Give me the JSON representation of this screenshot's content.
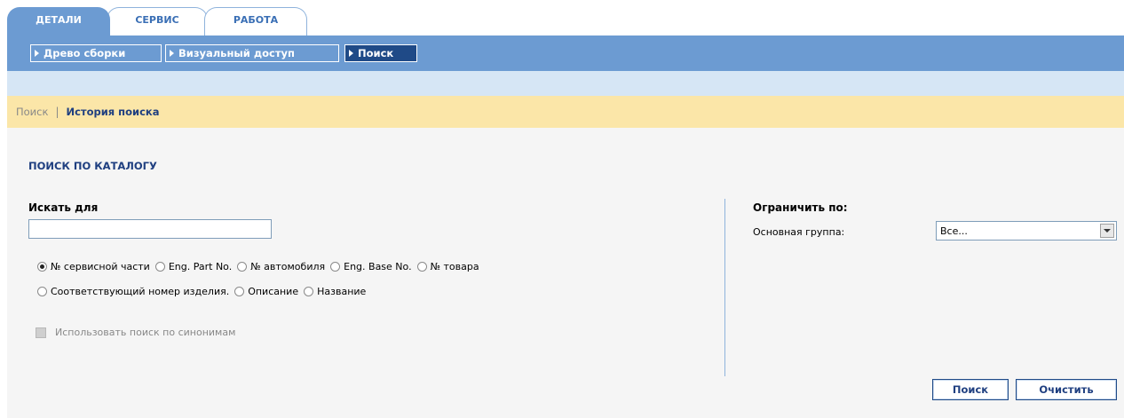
{
  "tabs": [
    {
      "label": "ДЕТАЛИ",
      "active": true
    },
    {
      "label": "СЕРВИС",
      "active": false
    },
    {
      "label": "РАБОТА",
      "active": false
    }
  ],
  "subnav": [
    {
      "label": "Древо сборки",
      "active": false
    },
    {
      "label": "Визуальный доступ",
      "active": false
    },
    {
      "label": "Поиск",
      "active": true
    }
  ],
  "breadcrumb": {
    "inactive": "Поиск",
    "separator": "|",
    "active": "История поиска"
  },
  "section_title": "ПОИСК ПО КАТАЛОГУ",
  "search_for": {
    "label": "Искать для",
    "value": ""
  },
  "radios_row1": [
    {
      "label": "№ сервисной части",
      "checked": true
    },
    {
      "label": "Eng. Part No.",
      "checked": false
    },
    {
      "label": "№ автомобиля",
      "checked": false
    },
    {
      "label": "Eng. Base No.",
      "checked": false
    },
    {
      "label": "№ товара",
      "checked": false
    }
  ],
  "radios_row2": [
    {
      "label": "Соответствующий номер изделия.",
      "checked": false
    },
    {
      "label": "Описание",
      "checked": false
    },
    {
      "label": "Название",
      "checked": false
    }
  ],
  "synonym_checkbox": {
    "label": "Использовать поиск по синонимам",
    "checked": false,
    "disabled": true
  },
  "restrict": {
    "title": "Ограничить по:",
    "group_label": "Основная группа:",
    "group_value": "Все..."
  },
  "buttons": {
    "search": "Поиск",
    "clear": "Очистить"
  },
  "colors": {
    "accent_blue": "#6c9bd2",
    "dark_blue": "#1f4a87",
    "yellow_band": "#fbe6a8",
    "light_band": "#d6e6f5"
  }
}
